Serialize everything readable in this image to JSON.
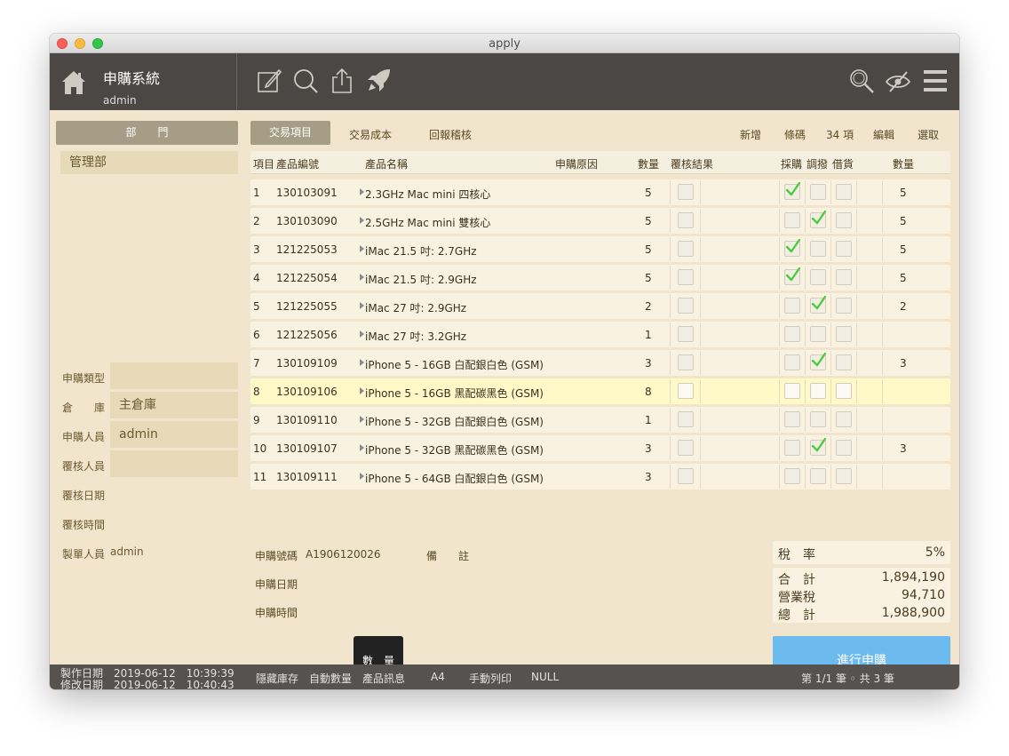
{
  "window": {
    "title": "apply"
  },
  "header": {
    "app_name": "申購系統",
    "user": "admin"
  },
  "sidebar": {
    "dept_button": "部　　門",
    "dept_items": [
      "管理部"
    ],
    "fields": [
      {
        "label": "申購類型",
        "value": ""
      },
      {
        "label": "倉　　庫",
        "value": "主倉庫"
      },
      {
        "label": "申購人員",
        "value": "admin"
      },
      {
        "label": "覆核人員",
        "value": ""
      },
      {
        "label": "覆核日期",
        "value": ""
      },
      {
        "label": "覆核時間",
        "value": ""
      },
      {
        "label": "製單人員",
        "value": "admin"
      }
    ]
  },
  "tabs": [
    "交易項目",
    "交易成本",
    "回報稽核"
  ],
  "toolbar": {
    "add": "新增",
    "barcode": "條碼",
    "count": "34 項",
    "edit": "編輯",
    "select": "選取"
  },
  "columns": [
    "項目",
    "產品編號",
    "產品名稱",
    "申購原因",
    "數量",
    "覆核結果",
    "採購",
    "調撥",
    "借貨",
    "數量"
  ],
  "rows": [
    {
      "no": "1",
      "code": "130103091",
      "name": "2.3GHz Mac mini 四核心",
      "reason": "",
      "qty": "5",
      "review": false,
      "purchase": true,
      "transfer": false,
      "borrow": false,
      "qty2": "5",
      "selected": false
    },
    {
      "no": "2",
      "code": "130103090",
      "name": "2.5GHz Mac mini 雙核心",
      "reason": "",
      "qty": "5",
      "review": false,
      "purchase": false,
      "transfer": true,
      "borrow": false,
      "qty2": "5",
      "selected": false
    },
    {
      "no": "3",
      "code": "121225053",
      "name": "iMac 21.5 吋: 2.7GHz",
      "reason": "",
      "qty": "5",
      "review": false,
      "purchase": true,
      "transfer": false,
      "borrow": false,
      "qty2": "5",
      "selected": false
    },
    {
      "no": "4",
      "code": "121225054",
      "name": "iMac 21.5 吋: 2.9GHz",
      "reason": "",
      "qty": "5",
      "review": false,
      "purchase": true,
      "transfer": false,
      "borrow": false,
      "qty2": "5",
      "selected": false
    },
    {
      "no": "5",
      "code": "121225055",
      "name": "iMac 27 吋: 2.9GHz",
      "reason": "",
      "qty": "2",
      "review": false,
      "purchase": false,
      "transfer": true,
      "borrow": false,
      "qty2": "2",
      "selected": false
    },
    {
      "no": "6",
      "code": "121225056",
      "name": "iMac 27 吋: 3.2GHz",
      "reason": "",
      "qty": "1",
      "review": false,
      "purchase": false,
      "transfer": false,
      "borrow": false,
      "qty2": "",
      "selected": false
    },
    {
      "no": "7",
      "code": "130109109",
      "name": "iPhone 5 - 16GB 白配銀白色 (GSM)",
      "reason": "",
      "qty": "3",
      "review": false,
      "purchase": false,
      "transfer": true,
      "borrow": false,
      "qty2": "3",
      "selected": false
    },
    {
      "no": "8",
      "code": "130109106",
      "name": "iPhone 5 - 16GB 黑配碳黑色 (GSM)",
      "reason": "",
      "qty": "8",
      "review": false,
      "purchase": false,
      "transfer": false,
      "borrow": false,
      "qty2": "",
      "selected": true
    },
    {
      "no": "9",
      "code": "130109110",
      "name": "iPhone 5 - 32GB 白配銀白色 (GSM)",
      "reason": "",
      "qty": "1",
      "review": false,
      "purchase": false,
      "transfer": false,
      "borrow": false,
      "qty2": "",
      "selected": false
    },
    {
      "no": "10",
      "code": "130109107",
      "name": "iPhone 5 - 32GB 黑配碳黑色 (GSM)",
      "reason": "",
      "qty": "3",
      "review": false,
      "purchase": false,
      "transfer": true,
      "borrow": false,
      "qty2": "3",
      "selected": false
    },
    {
      "no": "11",
      "code": "130109111",
      "name": "iPhone 5 - 64GB 白配銀白色 (GSM)",
      "reason": "",
      "qty": "3",
      "review": false,
      "purchase": false,
      "transfer": false,
      "borrow": false,
      "qty2": "",
      "selected": false
    }
  ],
  "summary": {
    "order_no_label": "申購號碼",
    "order_no": "A1906120026",
    "note_label": "備　　註",
    "date_label": "申購日期",
    "time_label": "申購時間",
    "tax_rate_label": "稅　率",
    "tax_rate": "5%",
    "subtotal_label": "合　計",
    "subtotal": "1,894,190",
    "tax_label": "營業稅",
    "tax": "94,710",
    "total_label": "總　計",
    "total": "1,988,900",
    "qty_button": "數　量",
    "submit_button": "進行申購"
  },
  "footer": {
    "created": "製作日期　2019-06-12　10:39:39",
    "modified": "修改日期　2019-06-12　10:40:43",
    "actions": [
      "隱藏庫存",
      "自動數量",
      "產品訊息",
      "A4",
      "手動列印",
      "NULL"
    ],
    "pagination": "第 1/1 筆 ◦ 共 3 筆"
  },
  "icons": [
    "home-icon",
    "edit-icon",
    "search-icon",
    "share-icon",
    "rocket-icon",
    "search-icon",
    "eye-slash-icon",
    "menu-icon",
    "chevron-right-icon",
    "checkmark-icon"
  ],
  "colors": {
    "accent": "#a59d86",
    "header_bg": "#4a4744",
    "content_bg": "#f1e6cd",
    "check": "#4fcc3a",
    "submit": "#6dbbee",
    "selected_row": "#fff9c8"
  }
}
